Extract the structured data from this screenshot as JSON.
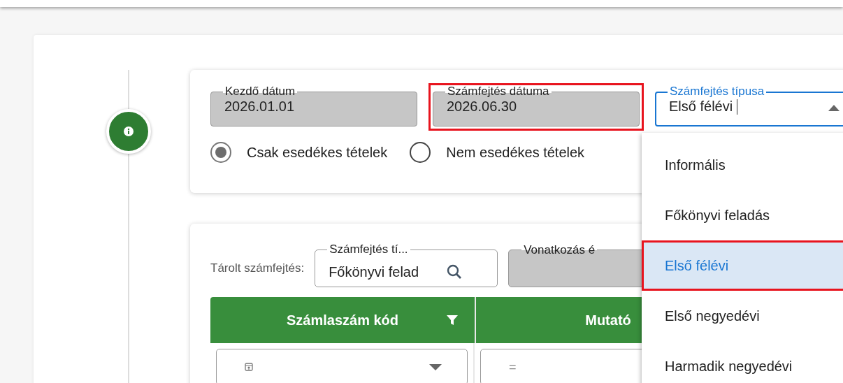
{
  "filter_panel": {
    "fields": [
      {
        "kind": "readonly",
        "label": "Kezdő dátum",
        "value": "2026.01.01",
        "highlighted": false,
        "focused": false
      },
      {
        "kind": "readonly",
        "label": "Számfejtés dátuma",
        "value": "2026.06.30",
        "highlighted": true,
        "focused": false
      },
      {
        "kind": "select",
        "label": "Számfejtés típusa",
        "value": "Első félévi",
        "highlighted": false,
        "focused": true
      }
    ],
    "radios": [
      {
        "label": "Csak esedékes tételek",
        "selected": true
      },
      {
        "label": "Nem esedékes tételek",
        "selected": false
      }
    ]
  },
  "dropdown": {
    "options": [
      {
        "label": "Informális",
        "selected": false,
        "highlighted": false
      },
      {
        "label": "Főkönyvi feladás",
        "selected": false,
        "highlighted": false
      },
      {
        "label": "Első félévi",
        "selected": true,
        "highlighted": true
      },
      {
        "label": "Első negyedévi",
        "selected": false,
        "highlighted": false
      },
      {
        "label": "Harmadik negyedévi",
        "selected": false,
        "highlighted": false
      }
    ]
  },
  "stored": {
    "label": "Tárolt számfejtés:",
    "search_field": {
      "label": "Számfejtés tí...",
      "value": "Főkönyvi felad"
    },
    "reference_field": {
      "label": "Vonatkozás é"
    }
  },
  "table": {
    "columns": [
      {
        "label": "Számlaszám kód",
        "filter": true
      },
      {
        "label": "Mutató"
      }
    ],
    "filter_row": [
      {
        "kind": "select"
      },
      {
        "kind": "operator",
        "placeholder": "="
      }
    ]
  }
}
